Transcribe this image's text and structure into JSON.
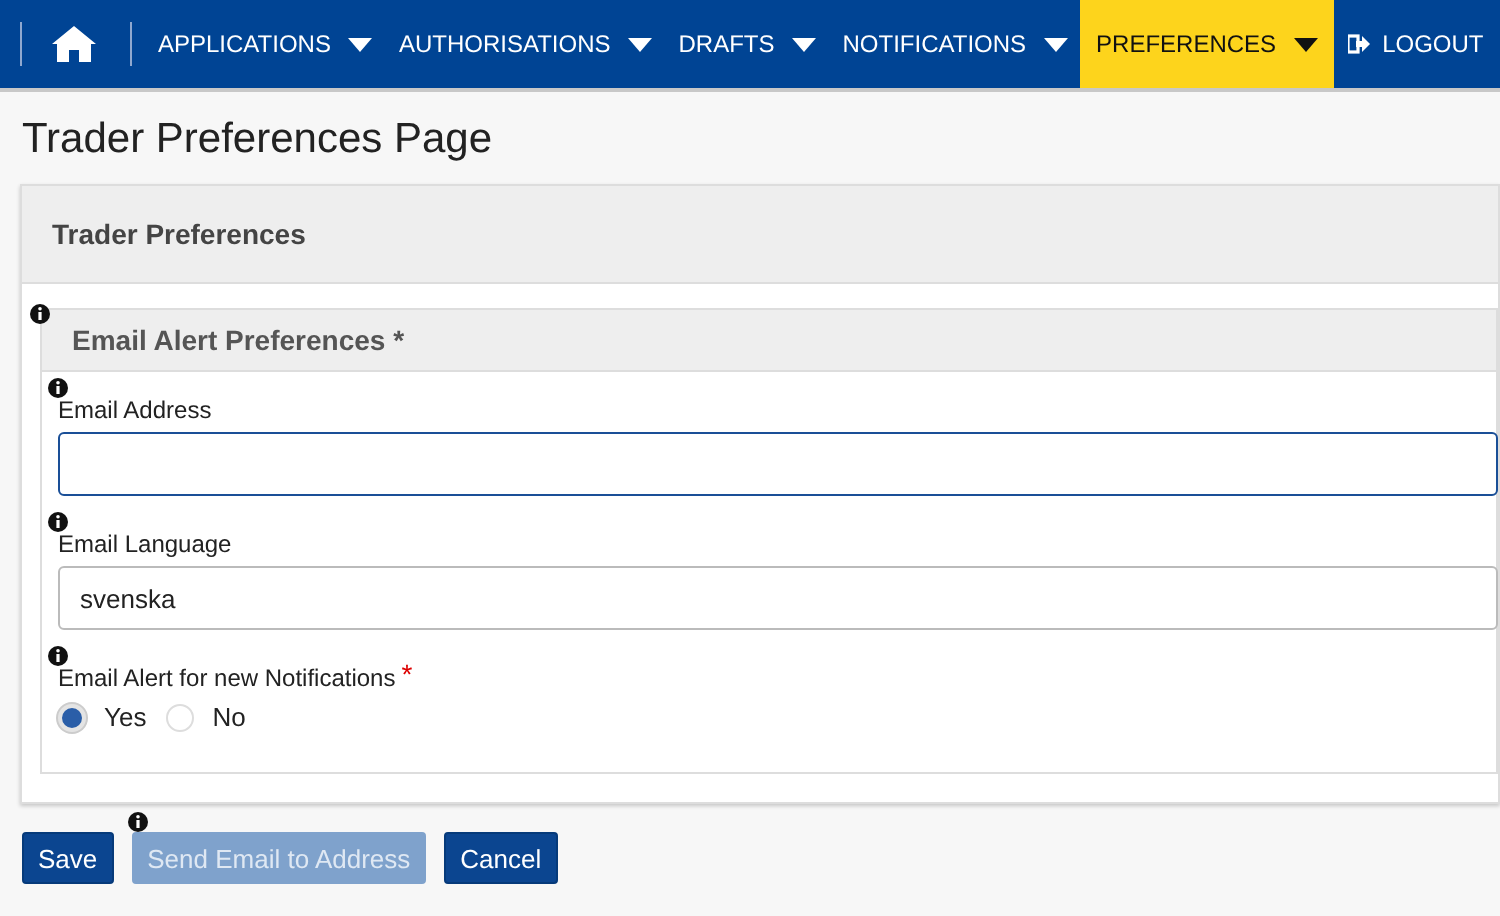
{
  "nav": {
    "items": [
      {
        "label": "APPLICATIONS",
        "kind": "menu",
        "selected": false
      },
      {
        "label": "AUTHORISATIONS",
        "kind": "menu",
        "selected": false
      },
      {
        "label": "DRAFTS",
        "kind": "menu",
        "selected": false
      },
      {
        "label": "NOTIFICATIONS",
        "kind": "menu",
        "selected": false
      },
      {
        "label": "PREFERENCES",
        "kind": "menu",
        "selected": true
      },
      {
        "label": "LOGOUT",
        "kind": "logout",
        "selected": false
      }
    ]
  },
  "page_title": "Trader Preferences Page",
  "panel": {
    "title": "Trader Preferences",
    "section": {
      "title": "Email Alert Preferences *",
      "fields": [
        {
          "kind": "input",
          "label": "Email Address",
          "focused": true
        },
        {
          "kind": "input",
          "label": "Email Language",
          "value": "svenska",
          "focused": false
        },
        {
          "kind": "radio",
          "label": "Email Alert for new Notifications",
          "required_marker": "*",
          "options": [
            {
              "label": "Yes",
              "selected": true
            },
            {
              "label": "No",
              "selected": false
            }
          ]
        }
      ]
    }
  },
  "buttons": [
    {
      "label": "Save",
      "disabled": false,
      "info": false
    },
    {
      "label": "Send Email to Address",
      "disabled": true,
      "info": true
    },
    {
      "label": "Cancel",
      "disabled": false,
      "info": false
    }
  ]
}
